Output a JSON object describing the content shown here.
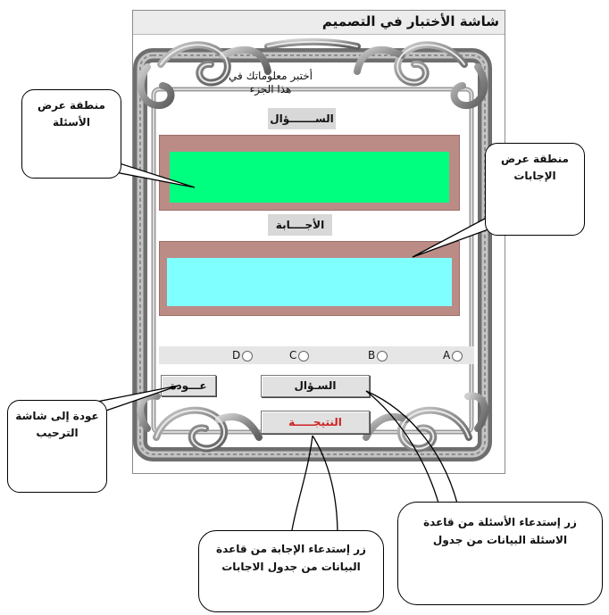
{
  "window": {
    "title": "شاشة الأختبار في التصميم",
    "prompt": "أختبر معلوماتك في هذا الجزء",
    "question_header": "الســـــــؤال",
    "answers_header": "الأجــــابة",
    "options": [
      "A",
      "B",
      "C",
      "D"
    ],
    "buttons": {
      "back": "عـــودة",
      "question": "السـؤال",
      "result": "النتيجـــــة"
    }
  },
  "callouts": {
    "question_area": "منطقة عرض الأسئلة",
    "answers_area": "منطقة عرض الإجابات",
    "back_button": "عودة إلى شاشة الترحيب",
    "question_button": "زر إستدعاء الأسئلة من قاعدة الاسئلة البيانات من جدول",
    "result_button": "زر إستدعاء الإجابة من قاعدة البيانات من جدول الاجابات"
  },
  "colors": {
    "question_fill": "#00ff7f",
    "answer_fill": "#7fffff",
    "area_border": "#bb8c86",
    "result_text": "#cc2222",
    "frame": "#9a9a9a"
  }
}
